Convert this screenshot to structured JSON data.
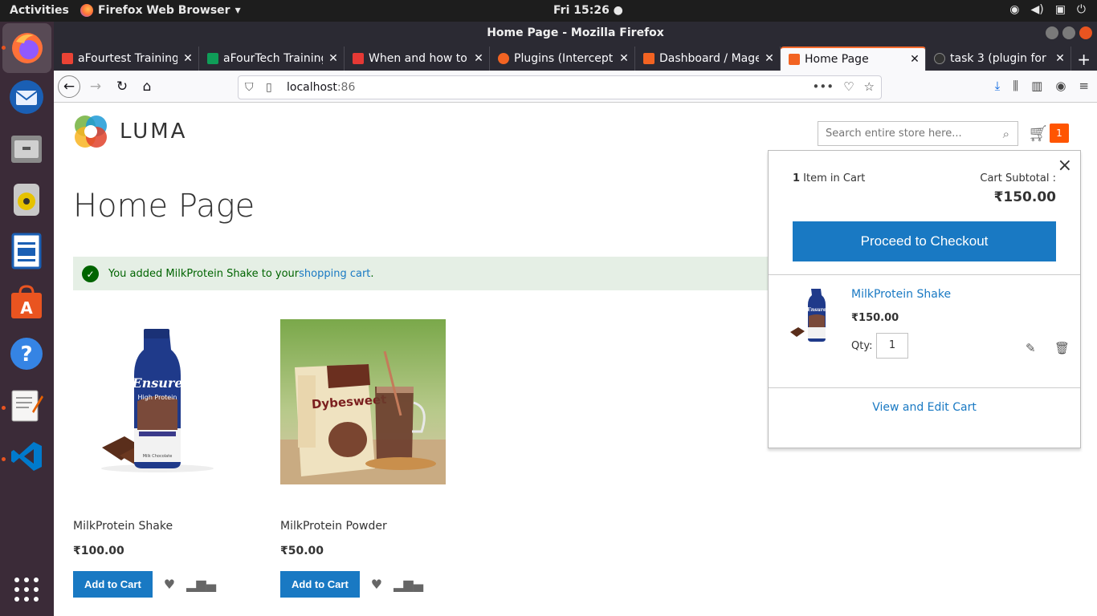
{
  "system": {
    "activities": "Activities",
    "app_name": "Firefox Web Browser",
    "clock": "Fri 15:26",
    "tray_icons": [
      "wifi-icon",
      "volume-icon",
      "clipboard-icon",
      "power-icon"
    ]
  },
  "dock": {
    "items": [
      "firefox",
      "thunderbird",
      "files",
      "rhythmbox",
      "writer",
      "software",
      "help",
      "text-editor",
      "vscode",
      "app-grid"
    ]
  },
  "window": {
    "title": "Home Page - Mozilla Firefox"
  },
  "tabs": [
    {
      "label": "aFourtest Training",
      "color": "#ea4335"
    },
    {
      "label": "aFourTech Training",
      "color": "#0f9d58"
    },
    {
      "label": "When and how to",
      "color": "#e53935"
    },
    {
      "label": "Plugins (Intercept",
      "color": "#f26322"
    },
    {
      "label": "Dashboard / Mage",
      "color": "#f26322"
    },
    {
      "label": "Home Page",
      "color": "#f26322"
    },
    {
      "label": "task 3 (plugin for",
      "color": "#333333"
    }
  ],
  "newtab_label": "+",
  "url": {
    "host": "localhost",
    "port": ":86"
  },
  "store": {
    "brand": "LUMA",
    "search_placeholder": "Search entire store here...",
    "cart_count": "1",
    "page_title": "Home Page",
    "message_prefix": "You added MilkProtein Shake to your ",
    "message_link": "shopping cart",
    "message_suffix": "."
  },
  "products": [
    {
      "name": "MilkProtein Shake",
      "price": "₹100.00",
      "button": "Add to Cart"
    },
    {
      "name": "MilkProtein Powder",
      "price": "₹50.00",
      "button": "Add to Cart"
    }
  ],
  "minicart": {
    "count_num": "1",
    "count_label": " Item in Cart",
    "subtotal_label": "Cart Subtotal :",
    "subtotal": "₹150.00",
    "checkout": "Proceed to Checkout",
    "item_name": "MilkProtein Shake",
    "item_price": "₹150.00",
    "qty_label": "Qty:",
    "qty": "1",
    "view_edit": "View and Edit Cart",
    "close": "×"
  },
  "colors": {
    "accent": "#1979c3",
    "cart_badge": "#ff5501",
    "success_bg": "#e5efe5"
  }
}
